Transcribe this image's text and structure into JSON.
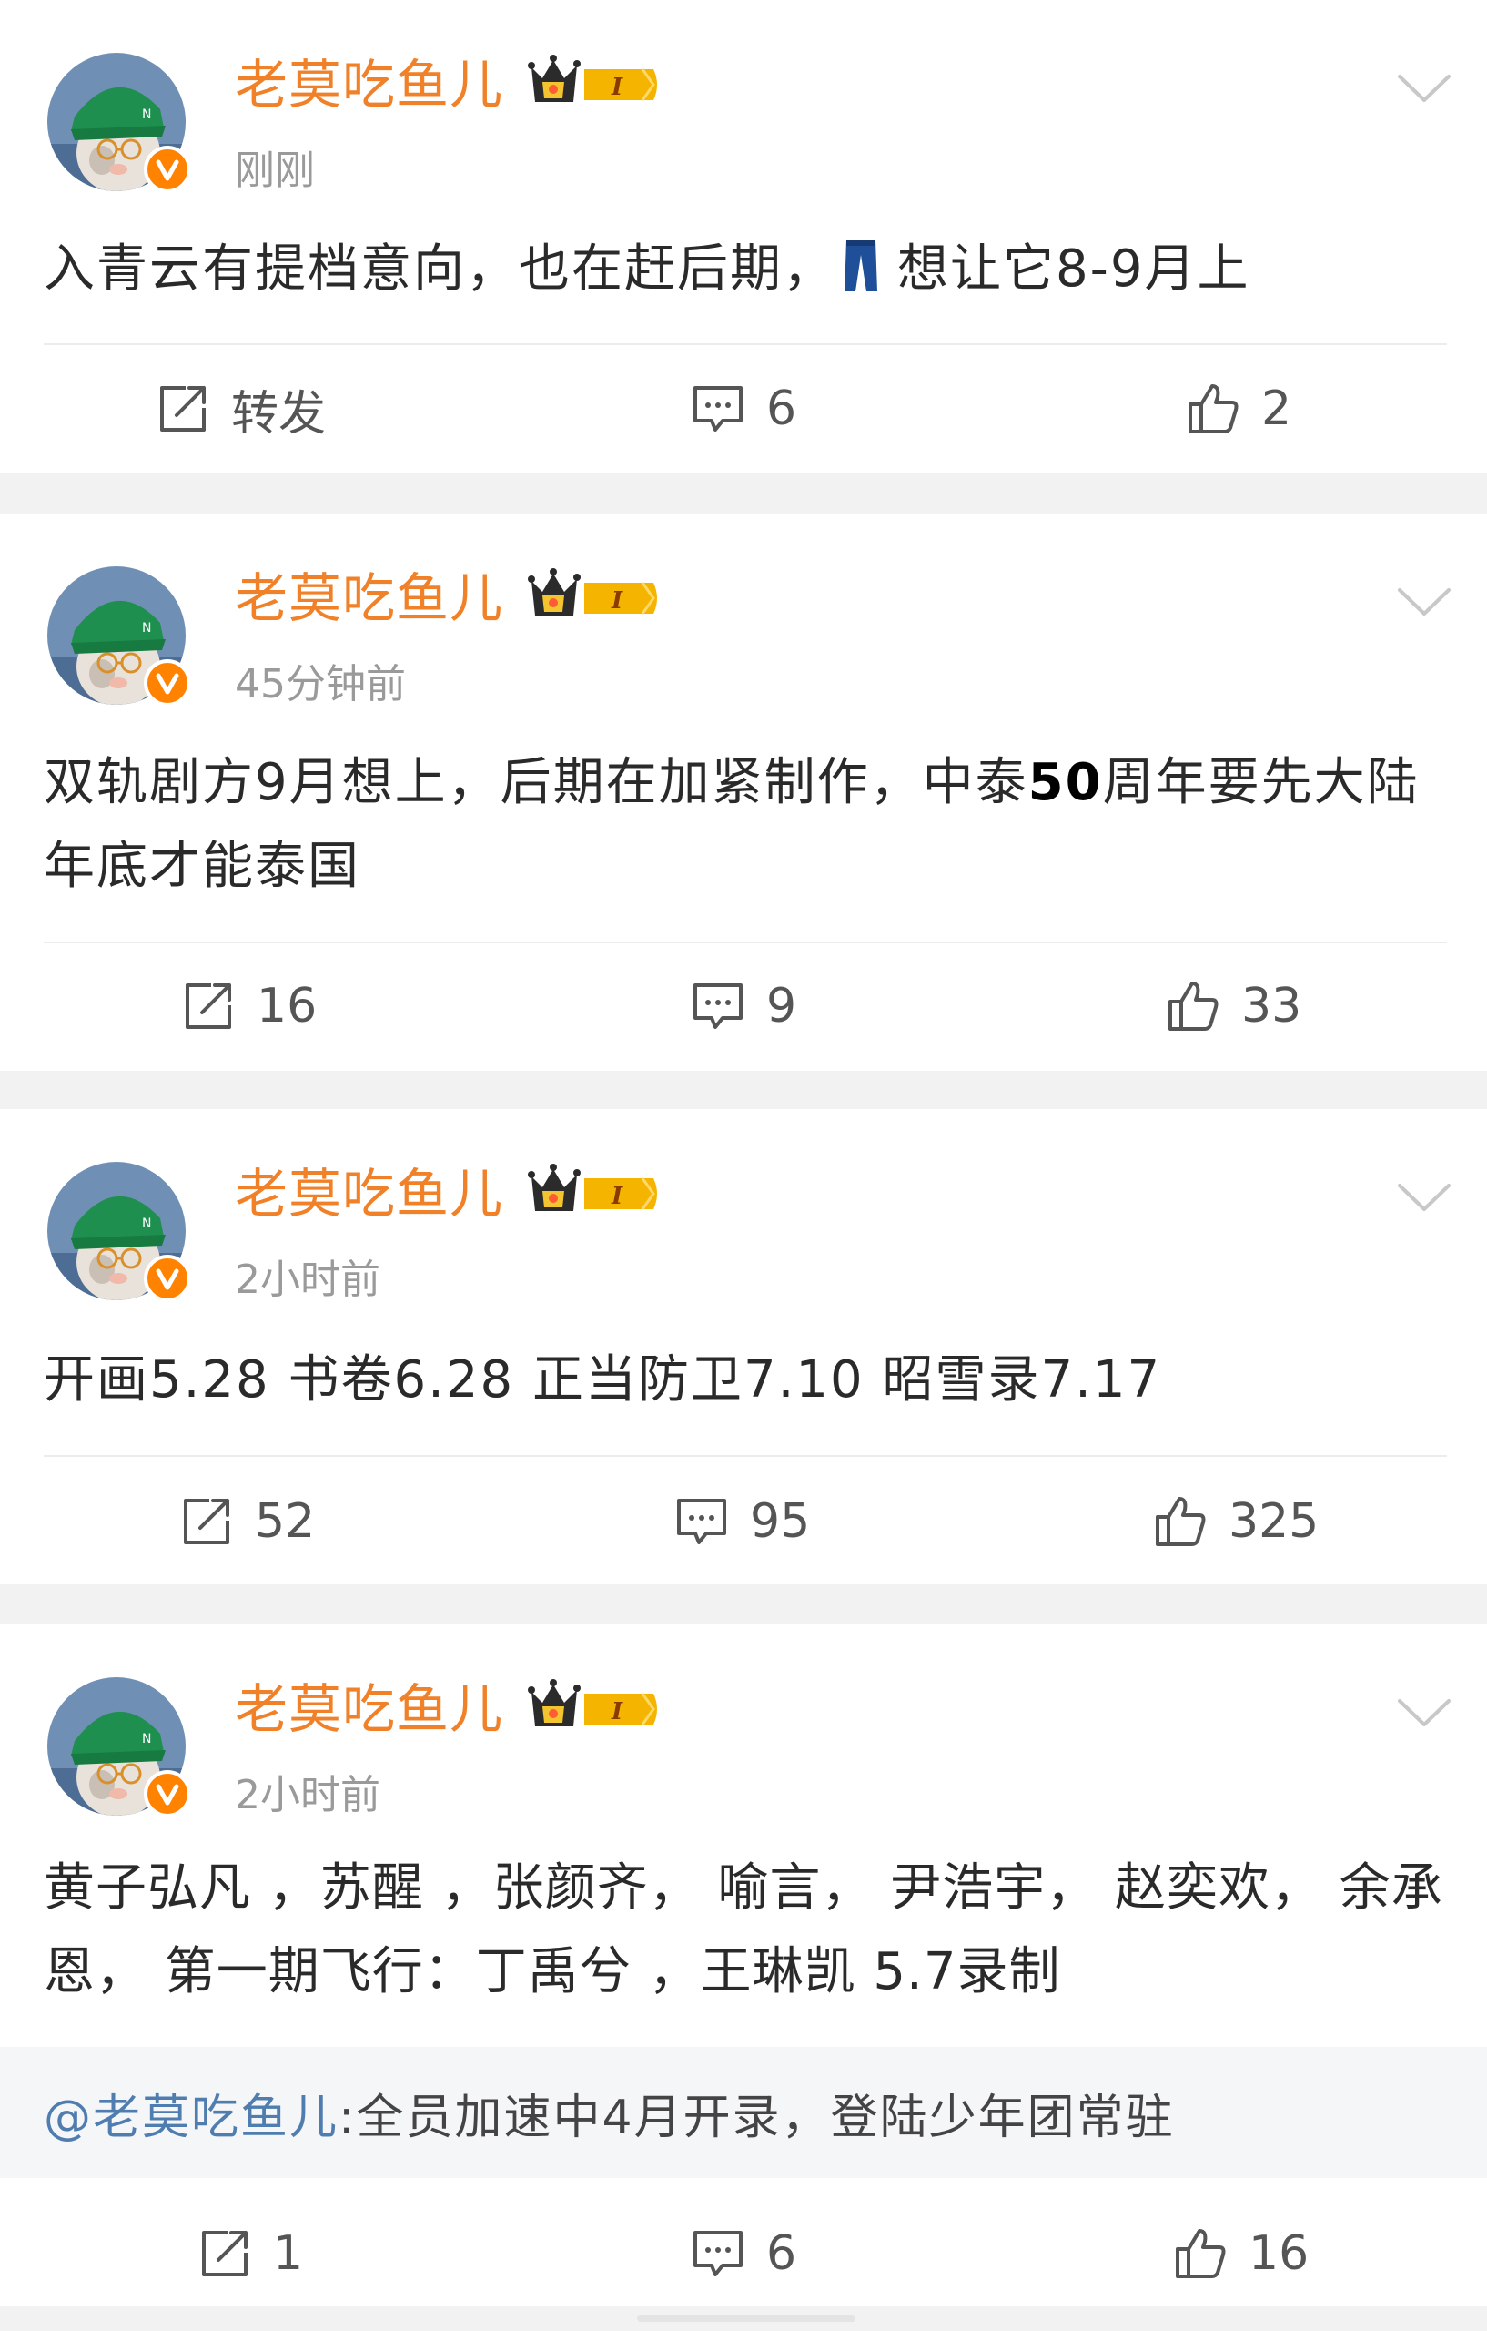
{
  "colors": {
    "username": "#f08128",
    "verified": "#ff8200",
    "mention": "#507daf",
    "separator": "#f2f2f2"
  },
  "posts": [
    {
      "username": "老莫吃鱼儿",
      "time": "刚刚",
      "content_a": "入青云有提档意向，也在赶后期，",
      "content_icon": "jeans-icon",
      "content_b": "想让它8-9月上",
      "repost": "转发",
      "comments": "6",
      "likes": "2"
    },
    {
      "username": "老莫吃鱼儿",
      "time": "45分钟前",
      "content_a": "双轨剧方9月想上，后期在加紧制作，中泰",
      "content_bold": "50",
      "content_b": "周年要先大陆年底才能泰国",
      "repost": "16",
      "comments": "9",
      "likes": "33"
    },
    {
      "username": "老莫吃鱼儿",
      "time": "2小时前",
      "content": "开画5.28 书卷6.28 正当防卫7.10 昭雪录7.17",
      "repost": "52",
      "comments": "95",
      "likes": "325"
    },
    {
      "username": "老莫吃鱼儿",
      "time": "2小时前",
      "content": "黄子弘凡 ，苏醒 ，张颜齐， 喻言， 尹浩宇， 赵奕欢， 余承恩， 第一期飞行：丁禹兮 ，王琳凯 5.7录制",
      "quote_mention": "@老莫吃鱼儿",
      "quote_text": " :全员加速中4月开录，登陆少年团常驻",
      "repost": "1",
      "comments": "6",
      "likes": "16"
    }
  ],
  "icons": {
    "repost": "repost-icon",
    "comment": "comment-icon",
    "like": "thumbs-up-icon",
    "more": "chevron-down-icon",
    "badge": "crown-level-badge-icon",
    "verified": "verified-v-icon"
  }
}
